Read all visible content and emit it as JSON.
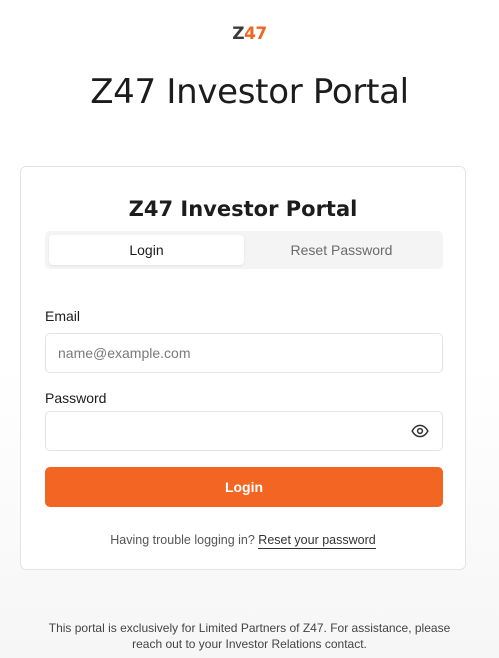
{
  "brand": {
    "logo_z": "Z",
    "logo_num": "47",
    "accent_color": "#f26522"
  },
  "page": {
    "title": "Z47 Investor Portal"
  },
  "card": {
    "title": "Z47 Investor Portal",
    "tabs": [
      {
        "label": "Login",
        "active": true
      },
      {
        "label": "Reset Password",
        "active": false
      }
    ],
    "email": {
      "label": "Email",
      "placeholder": "name@example.com",
      "value": ""
    },
    "password": {
      "label": "Password",
      "value": "",
      "toggle_icon": "eye-icon"
    },
    "submit_label": "Login",
    "help": {
      "prefix": "Having trouble logging in?",
      "link": "Reset your password"
    }
  },
  "footer": {
    "line1": "This portal is exclusively for Limited Partners of Z47. For assistance, please",
    "line2": "reach out to your Investor Relations contact."
  }
}
